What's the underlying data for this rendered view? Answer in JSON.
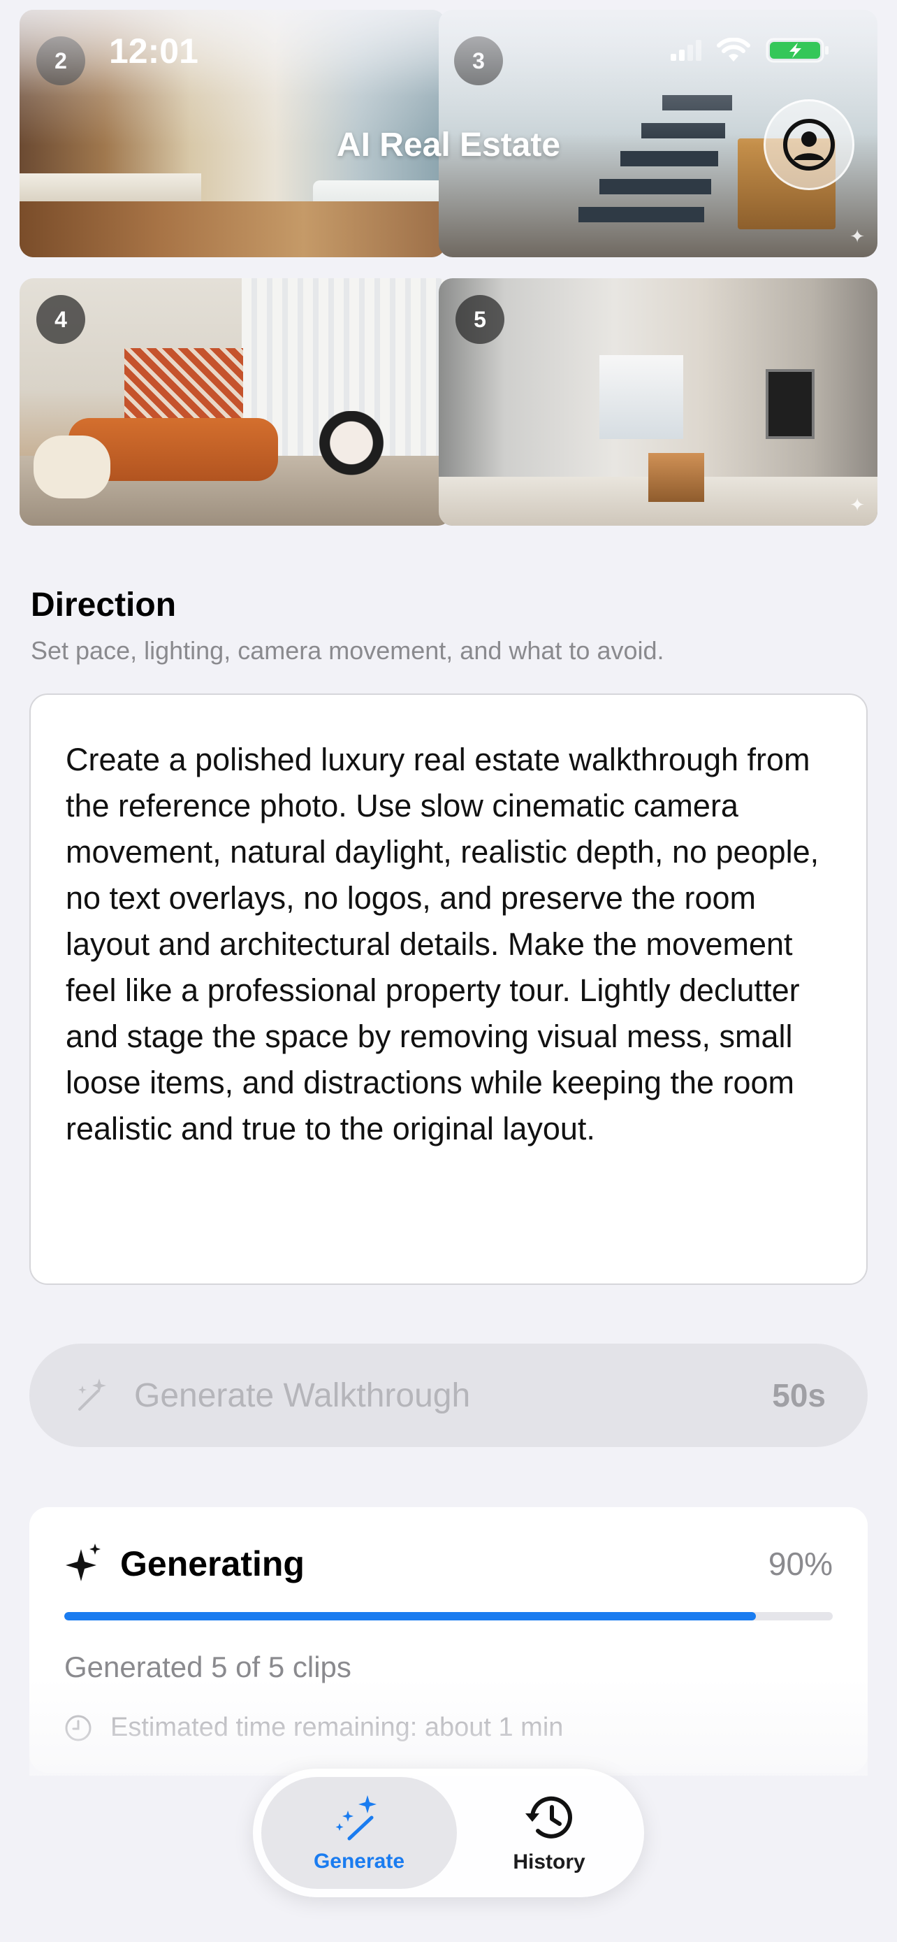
{
  "status_bar": {
    "time": "12:01",
    "icons": [
      "cellular-signal-icon",
      "wifi-icon",
      "battery-charging-icon"
    ]
  },
  "header": {
    "title": "AI Real Estate",
    "profile_icon": "person-circle-icon"
  },
  "photos": [
    {
      "badge": "2",
      "scene": "bathroom"
    },
    {
      "badge": "3",
      "scene": "staircase"
    },
    {
      "badge": "4",
      "scene": "living-room"
    },
    {
      "badge": "5",
      "scene": "kitchen"
    }
  ],
  "direction": {
    "title": "Direction",
    "subtitle": "Set pace, lighting, camera movement, and what to avoid.",
    "prompt": "Create a polished luxury real estate walkthrough from the reference photo. Use slow cinematic camera movement, natural daylight, realistic depth, no people, no text overlays, no logos, and preserve the room layout and architectural details. Make the movement feel like a professional property tour. Lightly declutter and stage the space by removing visual mess, small loose items, and distractions while keeping the room realistic and true to the original layout."
  },
  "generate_button": {
    "label": "Generate Walkthrough",
    "duration": "50s",
    "icon": "magic-wand-sparkles-icon",
    "enabled": false
  },
  "progress": {
    "title": "Generating",
    "percent_label": "90%",
    "fraction": 0.9,
    "clips_status": "Generated 5 of 5 clips",
    "eta": "Estimated time remaining: about 1 min",
    "accent": "#1a7cf0"
  },
  "tabbar": {
    "tabs": [
      {
        "label": "Generate",
        "icon": "magic-wand-sparkles-icon",
        "active": true
      },
      {
        "label": "History",
        "icon": "clock-history-icon",
        "active": false
      }
    ]
  },
  "colors": {
    "background": "#f2f2f7",
    "accent": "#1a7cf0",
    "secondary_text": "#8a8a8e"
  }
}
